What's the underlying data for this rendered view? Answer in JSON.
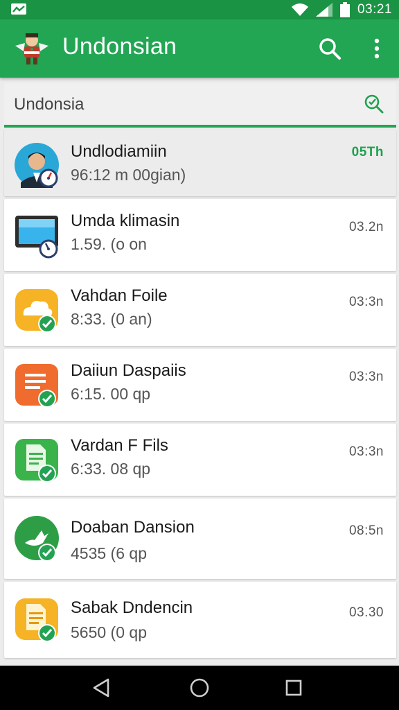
{
  "status_bar": {
    "time": "03:21",
    "icons": [
      "notification-icon",
      "wifi-icon",
      "signal-icon",
      "battery-icon"
    ]
  },
  "app_bar": {
    "title": "Undonsian",
    "actions": [
      "search-icon",
      "more-vert-icon"
    ],
    "color": "#22a654"
  },
  "search": {
    "value": "Undonsia",
    "action_icon": "search-check-icon"
  },
  "list": [
    {
      "title": "Undlodiamiin",
      "subtitle": "96:12 m 00gian)",
      "time": "05Th",
      "icon": "person-avatar-icon",
      "selected": true
    },
    {
      "title": "Umda klimasin",
      "subtitle": "1.59. (o on",
      "time": "03.2n",
      "icon": "monitor-app-icon",
      "selected": false
    },
    {
      "title": "Vahdan Foile",
      "subtitle": "8:33. (0 an)",
      "time": "03:3n",
      "icon": "cloud-app-icon",
      "selected": false
    },
    {
      "title": "Daiiun Daspaiis",
      "subtitle": "6:15. 00 qp",
      "time": "03:3n",
      "icon": "document-app-icon",
      "selected": false
    },
    {
      "title": "Vardan F Fils",
      "subtitle": "6:33. 08 qp",
      "time": "03:3n",
      "icon": "file-app-icon",
      "selected": false
    },
    {
      "title": "Doaban Dansion",
      "subtitle": "4535 (6 qp",
      "time": "08:5n",
      "icon": "bird-app-icon",
      "selected": false
    },
    {
      "title": "Sabak Dndencin",
      "subtitle": "5650 (0 qp",
      "time": "03.30",
      "icon": "notes-app-icon",
      "selected": false
    }
  ],
  "nav_bar": {
    "buttons": [
      "back-icon",
      "home-icon",
      "recents-icon"
    ]
  }
}
